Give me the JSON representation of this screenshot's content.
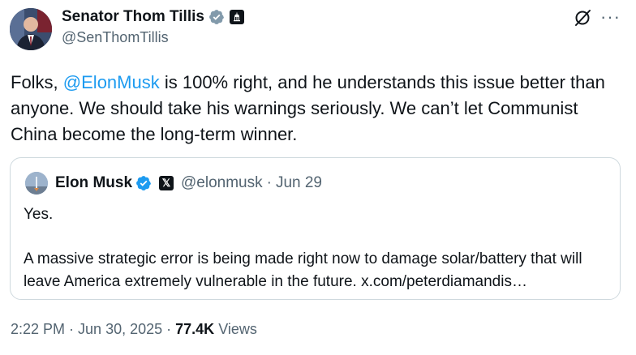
{
  "author": {
    "name": "Senator Thom Tillis",
    "handle": "@SenThomTillis",
    "avatar_icon": "portrait-avatar",
    "verified_icon": "verified-gray-icon",
    "affiliation_icon": "capitol-badge-icon"
  },
  "header_actions": {
    "grok_icon": "grok-icon",
    "more_label": "···"
  },
  "tweet": {
    "text_before": "Folks, ",
    "mention": "@ElonMusk",
    "text_after": " is 100% right, and he understands this issue better than anyone. We should take his warnings seriously. We can’t let Communist China become the long-term winner."
  },
  "quote": {
    "name": "Elon Musk",
    "affiliation_label": "𝕏",
    "handle": "@elonmusk",
    "separator": "·",
    "date": "Jun 29",
    "line1": "Yes.",
    "body": "A massive strategic error is being made right now to damage solar/battery that will leave America extremely vulnerable in the future. x.com/peterdiamandis…"
  },
  "meta": {
    "time": "2:22 PM",
    "date": "Jun 30, 2025",
    "views_count": "77.4K",
    "views_label": "Views",
    "separator": "·"
  },
  "colors": {
    "mention": "#1d9bf0",
    "secondary_text": "#536471",
    "verified_blue": "#1d9bf0",
    "verified_gray": "#829aab"
  }
}
